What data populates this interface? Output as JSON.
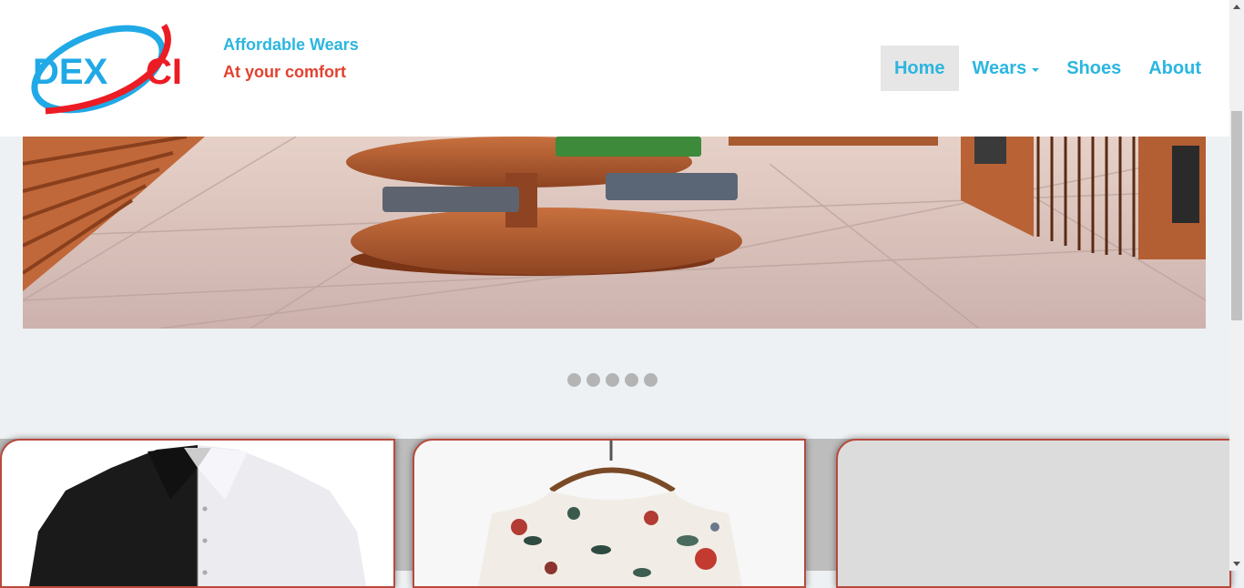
{
  "header": {
    "logo_text_left": "DEX",
    "logo_text_right": "CI",
    "tagline_primary": "Affordable Wears",
    "tagline_secondary": "At your comfort"
  },
  "nav": {
    "items": [
      {
        "label": "Home",
        "active": true
      },
      {
        "label": "Wears",
        "has_dropdown": true
      },
      {
        "label": "Shoes"
      },
      {
        "label": "About"
      }
    ]
  },
  "carousel": {
    "slide_count": 5,
    "indicator_color": "#b4b4b4"
  },
  "products": [
    {
      "name": "black-white-shirt"
    },
    {
      "name": "floral-top"
    },
    {
      "name": "empty-product-card"
    }
  ],
  "colors": {
    "accent_blue": "#2bb6e0",
    "accent_red": "#e2412f",
    "card_border": "#b84a3c"
  }
}
